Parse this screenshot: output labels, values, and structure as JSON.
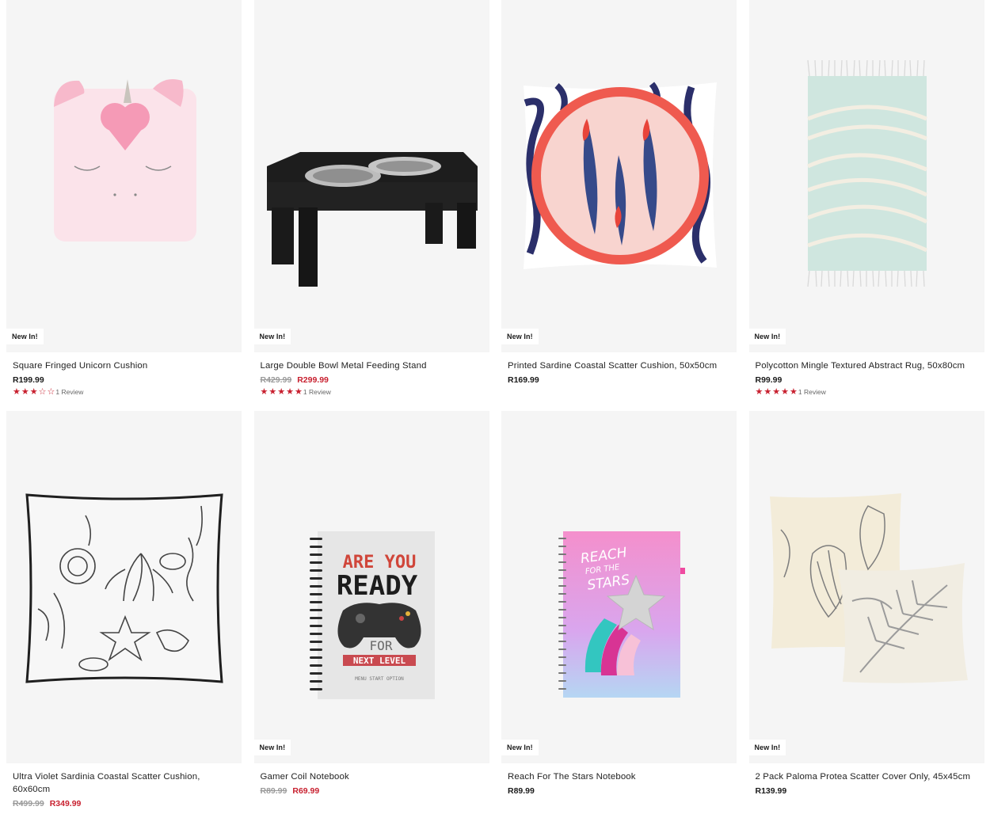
{
  "products": [
    {
      "name": "Square Fringed Unicorn Cushion",
      "badge": "New In!",
      "old_price": "",
      "price": "R199.99",
      "rating": 3,
      "rating_max": 5,
      "reviews": "1 Review",
      "image": "unicorn-cushion-image"
    },
    {
      "name": "Large Double Bowl Metal Feeding Stand",
      "badge": "New In!",
      "old_price": "R429.99",
      "price": "R299.99",
      "rating": 5,
      "rating_max": 5,
      "reviews": "1 Review",
      "image": "feeding-stand-image"
    },
    {
      "name": "Printed Sardine Coastal Scatter Cushion, 50x50cm",
      "badge": "New In!",
      "old_price": "",
      "price": "R169.99",
      "rating": 0,
      "rating_max": 5,
      "reviews": "",
      "image": "sardine-cushion-image"
    },
    {
      "name": "Polycotton Mingle Textured Abstract Rug, 50x80cm",
      "badge": "New In!",
      "old_price": "",
      "price": "R99.99",
      "rating": 5,
      "rating_max": 5,
      "reviews": "1 Review",
      "image": "rug-image"
    },
    {
      "name": "Ultra Violet Sardinia Coastal Scatter Cushion, 60x60cm",
      "badge": "",
      "old_price": "R499.99",
      "price": "R349.99",
      "rating": 0,
      "rating_max": 5,
      "reviews": "",
      "image": "sardinia-cushion-image"
    },
    {
      "name": "Gamer Coil Notebook",
      "badge": "New In!",
      "old_price": "R89.99",
      "price": "R69.99",
      "rating": 0,
      "rating_max": 5,
      "reviews": "",
      "image": "gamer-notebook-image",
      "cover_text": [
        "ARE YOU",
        "READY",
        "FOR",
        "NEXT LEVEL",
        "MENU START OPTION"
      ]
    },
    {
      "name": "Reach For The Stars Notebook",
      "badge": "New In!",
      "old_price": "",
      "price": "R89.99",
      "rating": 0,
      "rating_max": 5,
      "reviews": "",
      "image": "stars-notebook-image",
      "cover_text": [
        "REACH",
        "FOR THE",
        "STARS"
      ]
    },
    {
      "name": "2 Pack Paloma Protea Scatter Cover Only, 45x45cm",
      "badge": "New In!",
      "old_price": "",
      "price": "R139.99",
      "rating": 0,
      "rating_max": 5,
      "reviews": "",
      "image": "protea-cushion-image"
    }
  ],
  "colors": {
    "sale": "#c8202f",
    "old_price": "#9a9a9a",
    "card_bg": "#f5f5f5"
  },
  "icons": {
    "star": "star-icon"
  }
}
